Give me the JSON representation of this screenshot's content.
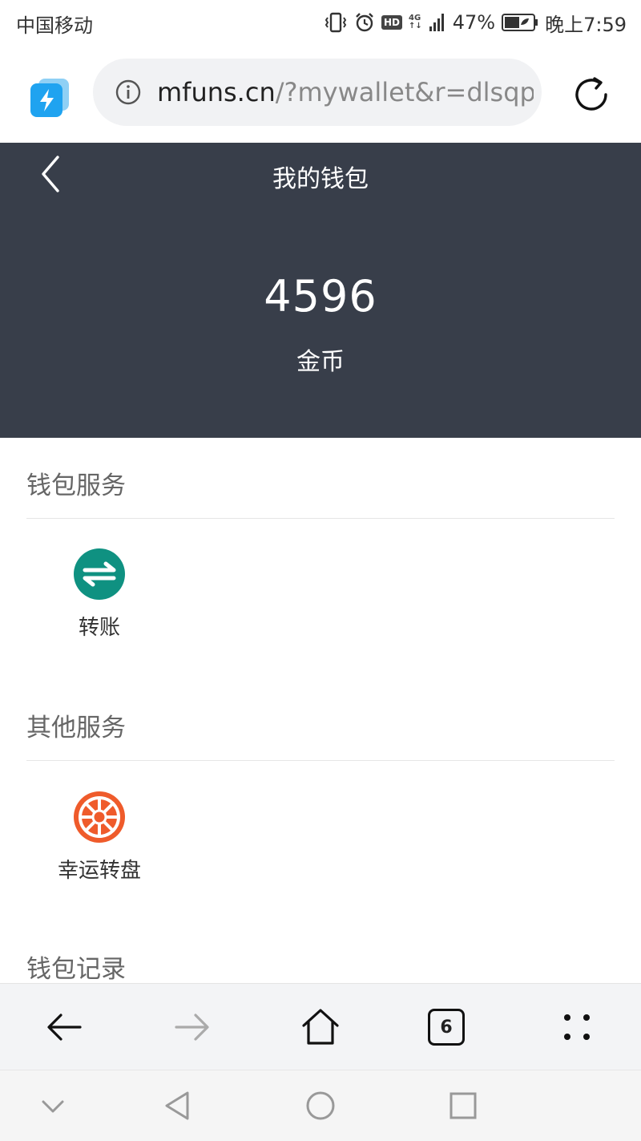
{
  "status_bar": {
    "carrier": "中国移动",
    "hd_badge": "HD",
    "network": "4G",
    "battery_percent": "47%",
    "time": "晚上7:59"
  },
  "address_bar": {
    "url_host": "mfuns.cn",
    "url_path": "/?mywallet&r=dlsqp"
  },
  "header": {
    "title": "我的钱包",
    "balance": "4596",
    "balance_unit": "金币",
    "background_color": "#383e4a"
  },
  "sections": {
    "wallet_services": {
      "title": "钱包服务",
      "items": [
        {
          "label": "转账",
          "icon": "transfer-icon",
          "color": "#0f9181"
        }
      ]
    },
    "other_services": {
      "title": "其他服务",
      "items": [
        {
          "label": "幸运转盘",
          "icon": "lucky-wheel-icon",
          "color": "#ef5b2b"
        }
      ]
    },
    "wallet_records": {
      "title": "钱包记录"
    }
  },
  "toolbar": {
    "tab_count": "6"
  }
}
